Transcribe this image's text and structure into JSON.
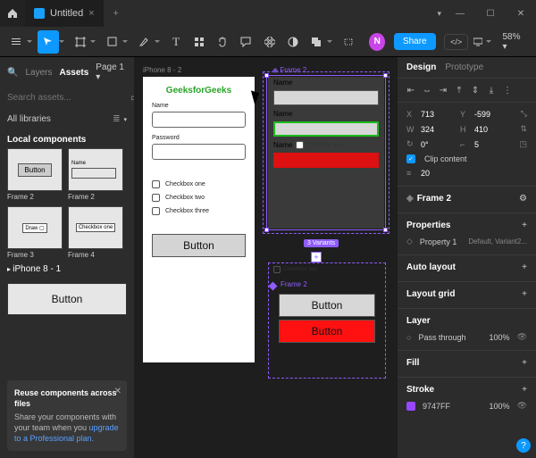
{
  "titlebar": {
    "tab_title": "Untitled"
  },
  "toolbar": {
    "avatar_initial": "N",
    "share": "Share",
    "zoom": "58%"
  },
  "left": {
    "tabs": {
      "layers": "Layers",
      "assets": "Assets",
      "pages": "Page 1"
    },
    "search_placeholder": "Search assets...",
    "libraries": "All libraries",
    "local_header": "Local components",
    "thumbs": [
      {
        "label": "Frame 2",
        "content": "Button"
      },
      {
        "label": "Frame 2",
        "content": "Name"
      },
      {
        "label": "Frame 3",
        "content": "Draw ▢"
      },
      {
        "label": "Frame 4",
        "content": "Checkbox one"
      }
    ],
    "layer_item": "iPhone 8 - 1",
    "big_button": "Button",
    "promo": {
      "title": "Reuse components across files",
      "body_a": "Share your components with your team when you ",
      "link": "upgrade to a Professional plan.",
      "body_b": ""
    }
  },
  "canvas": {
    "artboard1": {
      "frame_label": "iPhone 8 - 2",
      "title": "GeeksforGeeks",
      "name_label": "Name",
      "password_label": "Password",
      "checkboxes": [
        "Checkbox one",
        "Checkbox two",
        "Checkbox three"
      ],
      "button": "Button"
    },
    "frame2_a": {
      "frame_label": "Frame 2",
      "rows": [
        "Name",
        "Name",
        "Name"
      ],
      "cb_label": "Checkbox one"
    },
    "variants_badge": "3 Variants",
    "frame2_b": {
      "frame_label": "Frame 2",
      "btn_gray": "Button",
      "btn_red": "Button",
      "cb_label": "Checkbox two"
    }
  },
  "right": {
    "tabs": {
      "design": "Design",
      "prototype": "Prototype"
    },
    "pos": {
      "x_label": "X",
      "x": "713",
      "y_label": "Y",
      "y": "-599",
      "w_label": "W",
      "w": "324",
      "h_label": "H",
      "h": "410",
      "rot_label": "↻",
      "rot": "0°",
      "rad_label": "⌐",
      "rad": "5"
    },
    "clip": "Clip content",
    "gap_label": "≡",
    "gap": "20",
    "frame_h": "Frame 2",
    "props_h": "Properties",
    "prop_name": "Property 1",
    "prop_val": "Default, Variant2...",
    "autolayout": "Auto layout",
    "layoutgrid": "Layout grid",
    "layer_h": "Layer",
    "blend": "Pass through",
    "opacity": "100%",
    "fill_h": "Fill",
    "stroke_h": "Stroke",
    "stroke_hex": "9747FF",
    "stroke_op": "100%"
  }
}
